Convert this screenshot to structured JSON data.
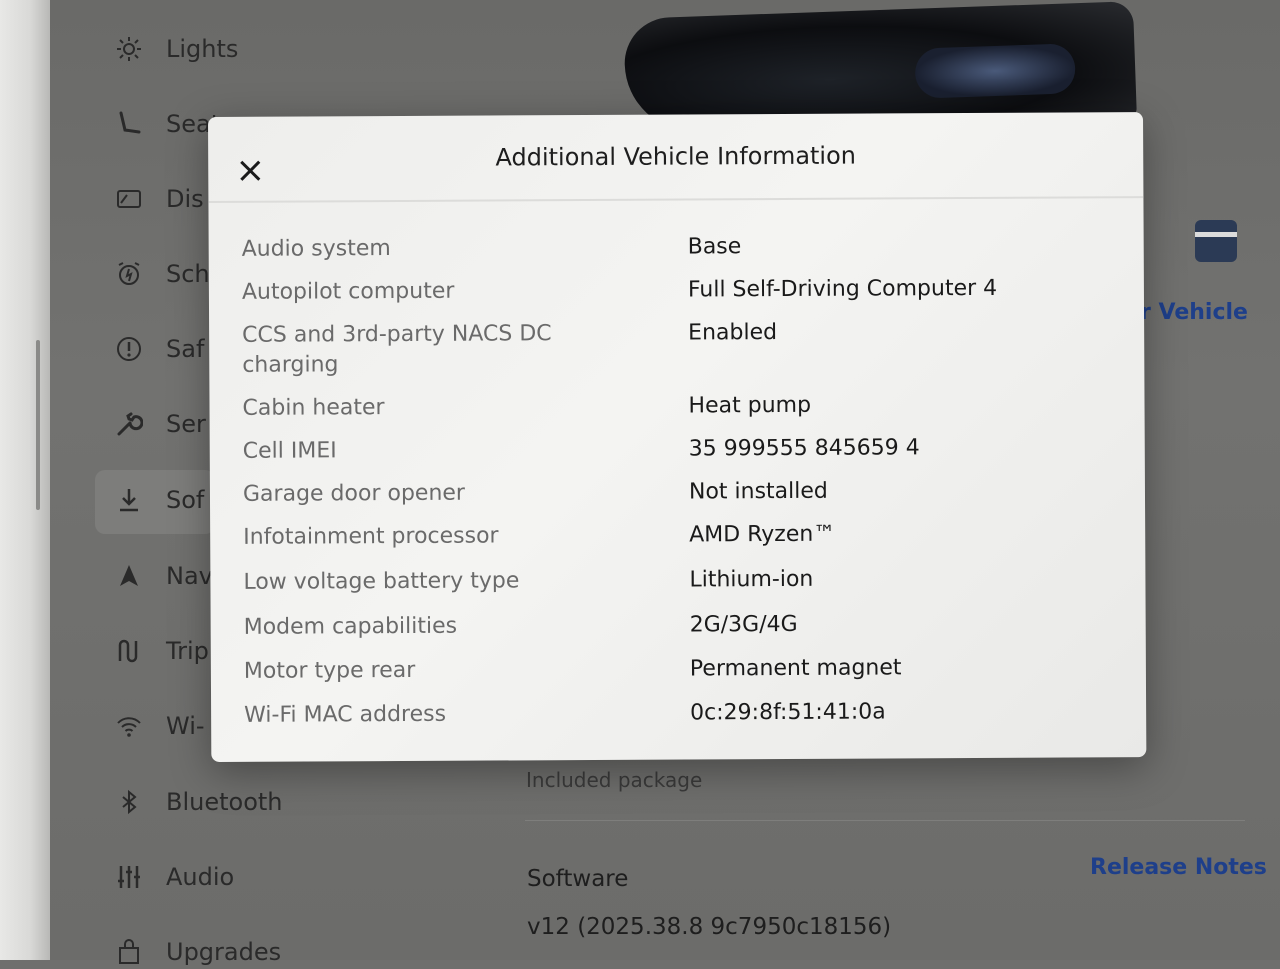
{
  "sidebar": {
    "items": [
      {
        "label": "Lights",
        "icon": "sun-icon"
      },
      {
        "label": "Seats",
        "icon": "seat-icon"
      },
      {
        "label": "Dis",
        "icon": "display-icon"
      },
      {
        "label": "Sch",
        "icon": "alarm-clock-icon"
      },
      {
        "label": "Saf",
        "icon": "alert-circle-icon"
      },
      {
        "label": "Ser",
        "icon": "wrench-icon"
      },
      {
        "label": "Sof",
        "icon": "download-icon"
      },
      {
        "label": "Nav",
        "icon": "navigation-arrow-icon"
      },
      {
        "label": "Trip",
        "icon": "trip-icon"
      },
      {
        "label": "Wi-",
        "icon": "wifi-icon"
      },
      {
        "label": "Bluetooth",
        "icon": "bluetooth-icon"
      },
      {
        "label": "Audio",
        "icon": "sliders-icon"
      },
      {
        "label": "Upgrades",
        "icon": "bag-icon"
      }
    ],
    "active_index": 6
  },
  "background": {
    "vehicle_link": "r Vehicle",
    "included_package": "Included package",
    "software_label": "Software",
    "release_notes": "Release Notes",
    "version": "v12 (2025.38.8 9c7950c18156)"
  },
  "modal": {
    "title": "Additional Vehicle Information",
    "close_icon": "close-icon",
    "rows": [
      {
        "label": "Audio system",
        "value": "Base"
      },
      {
        "label": "Autopilot computer",
        "value": "Full Self-Driving Computer 4"
      },
      {
        "label": "CCS and 3rd-party NACS DC charging",
        "value": "Enabled"
      },
      {
        "label": "Cabin heater",
        "value": "Heat pump"
      },
      {
        "label": "Cell IMEI",
        "value": "35 999555 845659 4"
      },
      {
        "label": "Garage door opener",
        "value": "Not installed"
      },
      {
        "label": "Infotainment processor",
        "value": "AMD Ryzen™"
      },
      {
        "label": "Low voltage battery type",
        "value": "Lithium-ion"
      },
      {
        "label": "Modem capabilities",
        "value": "2G/3G/4G"
      },
      {
        "label": "Motor type rear",
        "value": "Permanent magnet"
      },
      {
        "label": "Wi-Fi MAC address",
        "value": "0c:29:8f:51:41:0a"
      }
    ]
  },
  "colors": {
    "accent_link": "#1e3f8a",
    "modal_bg": "#f1f1ef",
    "screen_bg": "#6f6f6d"
  }
}
